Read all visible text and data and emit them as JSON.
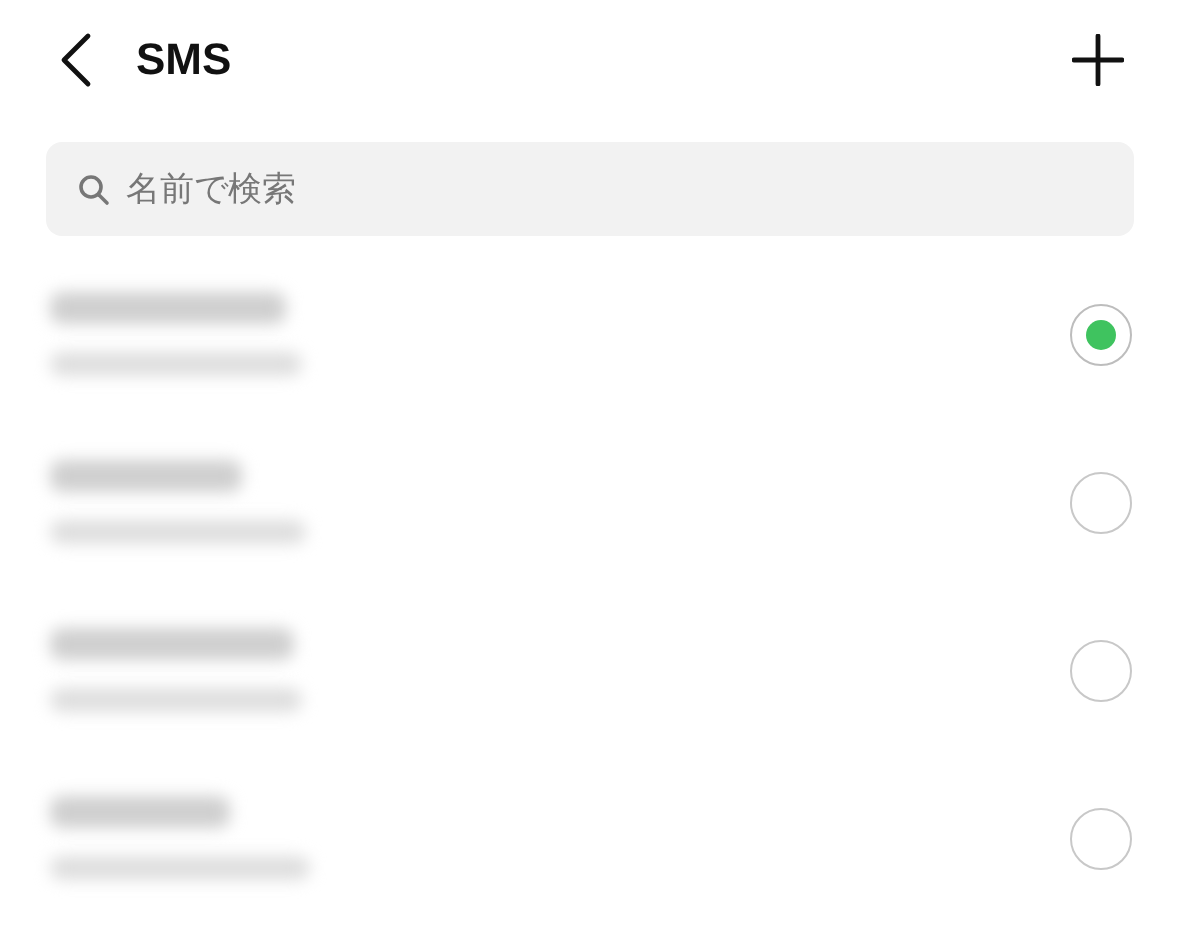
{
  "header": {
    "title": "SMS"
  },
  "search": {
    "placeholder": "名前で検索"
  },
  "contacts": [
    {
      "selected": true
    },
    {
      "selected": false
    },
    {
      "selected": false
    },
    {
      "selected": false
    }
  ]
}
